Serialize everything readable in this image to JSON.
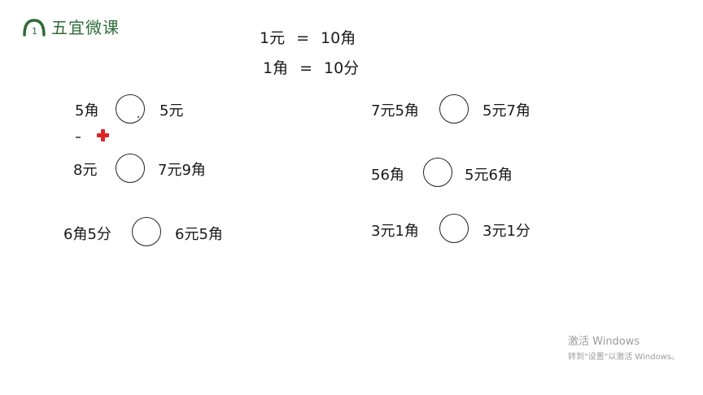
{
  "logo": {
    "text": "五宜微课",
    "mark_text": "1"
  },
  "rules": [
    {
      "left": "1元",
      "eq": "=",
      "right": "10角"
    },
    {
      "left": "1角",
      "eq": "=",
      "right": "10分"
    }
  ],
  "problems": [
    {
      "left": "5角",
      "right": "5元"
    },
    {
      "left": "8元",
      "right": "7元9角"
    },
    {
      "left": "6角5分",
      "right": "6元5角"
    },
    {
      "left": "7元5角",
      "right": "5元7角"
    },
    {
      "left": "56角",
      "right": "5元6角"
    },
    {
      "left": "3元1角",
      "right": "3元1分"
    }
  ],
  "watermark": {
    "line1": "激活 Windows",
    "line2": "转到\"设置\"以激活 Windows。"
  }
}
